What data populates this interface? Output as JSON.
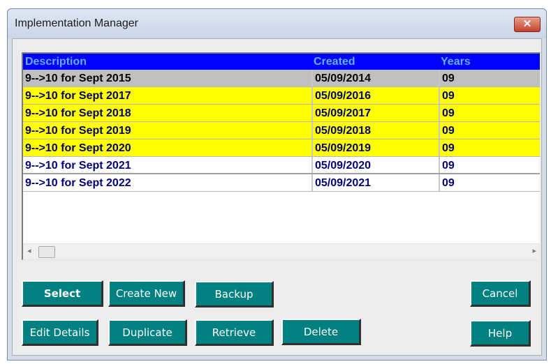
{
  "window": {
    "title": "Implementation Manager",
    "close_glyph": "✕"
  },
  "list": {
    "columns": [
      "Description",
      "Created",
      "Years"
    ],
    "rows": [
      {
        "description": "9-->10 for Sept 2015",
        "created": "05/09/2014",
        "years": "09",
        "style": "gray"
      },
      {
        "description": "9-->10 for Sept 2017",
        "created": "05/09/2016",
        "years": "09",
        "style": "yellow"
      },
      {
        "description": "9-->10 for Sept 2018",
        "created": "05/09/2017",
        "years": "09",
        "style": "yellow"
      },
      {
        "description": "9-->10 for Sept 2019",
        "created": "05/09/2018",
        "years": "09",
        "style": "yellow"
      },
      {
        "description": "9-->10 for Sept 2020",
        "created": "05/09/2019",
        "years": "09",
        "style": "yellow"
      },
      {
        "description": "9-->10 for Sept 2021",
        "created": "05/09/2020",
        "years": "09",
        "style": "white"
      },
      {
        "description": "9-->10 for Sept 2022",
        "created": "05/09/2021",
        "years": "09",
        "style": "white"
      }
    ],
    "scroll_left_glyph": "◂",
    "scroll_right_glyph": "▸"
  },
  "buttons": {
    "select": "Select",
    "create_new": "Create New",
    "backup": "Backup",
    "cancel": "Cancel",
    "edit_details": "Edit Details",
    "duplicate": "Duplicate",
    "retrieve": "Retrieve",
    "delete": "Delete",
    "help": "Help"
  },
  "colors": {
    "header_bg": "#0000ff",
    "header_text": "#5fb0ff",
    "selected_row": "#c0c0c0",
    "highlight_row": "#ffff00",
    "button_face": "#008080"
  }
}
